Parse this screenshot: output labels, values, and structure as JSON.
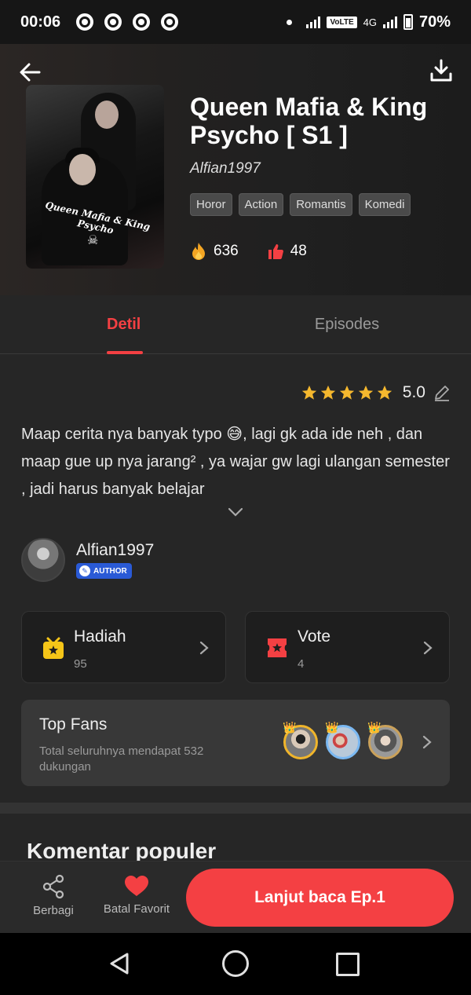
{
  "status_bar": {
    "time": "00:06",
    "volte": "VoLTE",
    "network": "4G",
    "battery": "70%"
  },
  "book": {
    "title": "Queen Mafia & King Psycho [ S1 ]",
    "author": "Alfian1997",
    "cover_text": "Queen Mafia & King Psycho",
    "tags": [
      "Horor",
      "Action",
      "Romantis",
      "Komedi"
    ],
    "fire_count": "636",
    "like_count": "48"
  },
  "tabs": {
    "detail": "Detil",
    "episodes": "Episodes"
  },
  "rating": {
    "score": "5.0",
    "stars": 5
  },
  "description": "Maap cerita nya banyak typo 😅, lagi gk ada ide neh , dan maap gue up nya jarang² , ya wajar gw lagi ulangan semester , jadi harus banyak belajar",
  "author_section": {
    "name": "Alfian1997",
    "badge": "AUTHOR"
  },
  "gift_card": {
    "label": "Hadiah",
    "count": "95"
  },
  "vote_card": {
    "label": "Vote",
    "count": "4"
  },
  "top_fans": {
    "label": "Top Fans",
    "subtitle": "Total seluruhnya mendapat 532 dukungan"
  },
  "comments": {
    "title": "Komentar populer"
  },
  "action_bar": {
    "share_label": "Berbagi",
    "favorite_label": "Batal Favorit",
    "continue_label": "Lanjut baca Ep.1"
  },
  "colors": {
    "accent": "#f44043",
    "background": "#262626",
    "card": "#1e1e1e",
    "star": "#f5b82e",
    "author_badge": "#2a5ad6"
  },
  "icons": [
    "back-arrow-icon",
    "download-icon",
    "fire-icon",
    "thumb-up-icon",
    "star-icon",
    "edit-icon",
    "chevron-down-icon",
    "gift-icon",
    "vote-ticket-icon",
    "chevron-right-icon",
    "share-icon",
    "heart-icon"
  ]
}
